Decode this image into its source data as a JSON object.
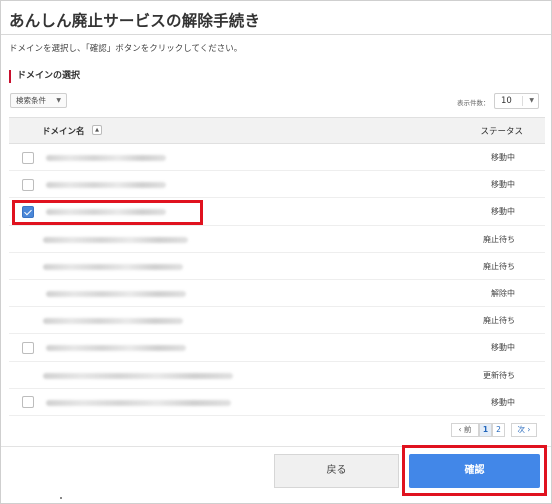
{
  "page": {
    "title": "あんしん廃止サービスの解除手続き",
    "instruction": "ドメインを選択し、「確認」ボタンをクリックしてください。",
    "section_heading": "ドメインの選択"
  },
  "toolbar": {
    "filter_label": "検索条件",
    "per_page_label": "表示件数：",
    "per_page_value": "10"
  },
  "table": {
    "col_domain": "ドメイン名",
    "col_status": "ステータス",
    "rows": [
      {
        "checkbox": true,
        "checked": false,
        "status": "移動中"
      },
      {
        "checkbox": true,
        "checked": false,
        "status": "移動中"
      },
      {
        "checkbox": true,
        "checked": true,
        "status": "移動中"
      },
      {
        "checkbox": false,
        "checked": false,
        "status": "廃止待ち"
      },
      {
        "checkbox": false,
        "checked": false,
        "status": "廃止待ち"
      },
      {
        "checkbox": false,
        "checked": false,
        "status": "解除中"
      },
      {
        "checkbox": false,
        "checked": false,
        "status": "廃止待ち"
      },
      {
        "checkbox": true,
        "checked": false,
        "status": "移動中"
      },
      {
        "checkbox": false,
        "checked": false,
        "status": "更新待ち"
      },
      {
        "checkbox": true,
        "checked": false,
        "status": "移動中"
      }
    ]
  },
  "pagination": {
    "prev": "‹ 前",
    "pages": [
      "1",
      "2"
    ],
    "current": "1",
    "next": "次 ›"
  },
  "buttons": {
    "back": "戻る",
    "confirm": "確認"
  },
  "colors": {
    "accent": "#4287e8",
    "highlight": "#e0121f",
    "section_bar": "#c8102e"
  }
}
